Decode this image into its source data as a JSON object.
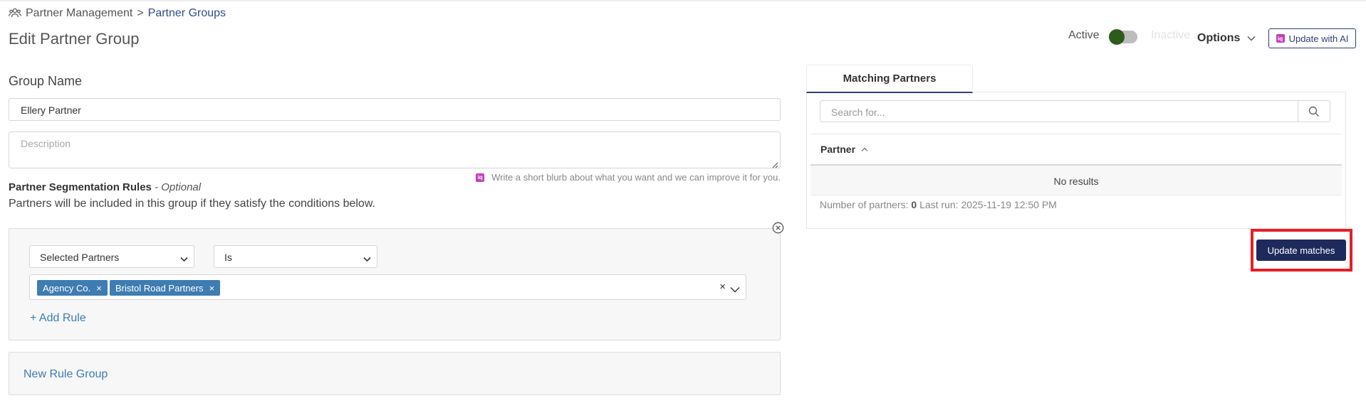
{
  "breadcrumb": {
    "icon": "users-icon",
    "parent": "Partner Management",
    "separator": ">",
    "current": "Partner Groups"
  },
  "page": {
    "title": "Edit Partner Group"
  },
  "header": {
    "active_label": "Active",
    "inactive_label": "Inactive",
    "toggle_state": "active",
    "options_label": "Options",
    "ai_button_label": "Update with AI"
  },
  "form": {
    "group_name_label": "Group Name",
    "group_name_value": "Ellery Partner",
    "description_placeholder": "Description",
    "blurb": "Write a short blurb about what you want and we can improve it for you."
  },
  "segmentation": {
    "title": "Partner Segmentation Rules",
    "title_suffix": "- Optional",
    "description": "Partners will be included in this group if they satisfy the conditions below.",
    "rule": {
      "field": "Selected Partners",
      "operator": "Is",
      "values": [
        "Agency Co.",
        "Bristol Road Partners"
      ],
      "clear_symbol": "×"
    },
    "add_rule_label": "+ Add Rule",
    "new_rule_group_label": "New Rule Group"
  },
  "matching": {
    "tab_label": "Matching Partners",
    "search_placeholder": "Search for...",
    "column_header": "Partner",
    "no_results": "No results",
    "count_label": "Number of partners:",
    "count_value": "0",
    "last_run_label": "Last run:",
    "last_run_value": "2025-11-19 12:50 PM",
    "update_button_label": "Update matches"
  },
  "colors": {
    "accent": "#2f3f7a",
    "link": "#3e7cb1",
    "tag": "#3e7cb1",
    "toggle_on": "#2d5a1d",
    "highlight": "#e41f26",
    "primary_button": "#1f2a5c",
    "ai_brand": "#c23fb5"
  }
}
